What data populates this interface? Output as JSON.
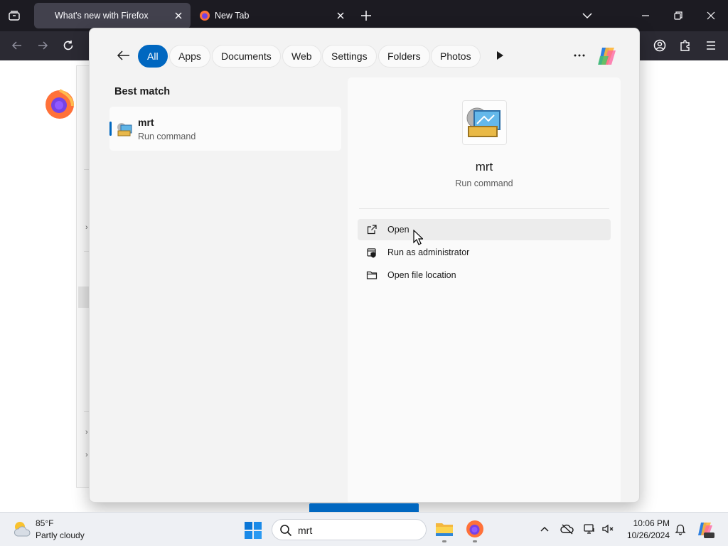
{
  "browser": {
    "tabs": [
      {
        "label": "What's new with Firefox",
        "active": true
      },
      {
        "label": "New Tab",
        "active": false
      }
    ]
  },
  "search": {
    "filters": [
      "All",
      "Apps",
      "Documents",
      "Web",
      "Settings",
      "Folders",
      "Photos"
    ],
    "active_filter": "All",
    "best_match_heading": "Best match",
    "result": {
      "name": "mrt",
      "type": "Run command"
    },
    "preview": {
      "name": "mrt",
      "type": "Run command",
      "actions": [
        "Open",
        "Run as administrator",
        "Open file location"
      ]
    }
  },
  "taskbar": {
    "weather": {
      "temp": "85°F",
      "condition": "Partly cloudy"
    },
    "search_value": "mrt",
    "clock": {
      "time": "10:06 PM",
      "date": "10/26/2024"
    }
  },
  "colors": {
    "accent": "#0067c0",
    "tabbar": "#1c1b22",
    "navbar": "#2b2a33",
    "flyout": "#f3f3f3"
  }
}
